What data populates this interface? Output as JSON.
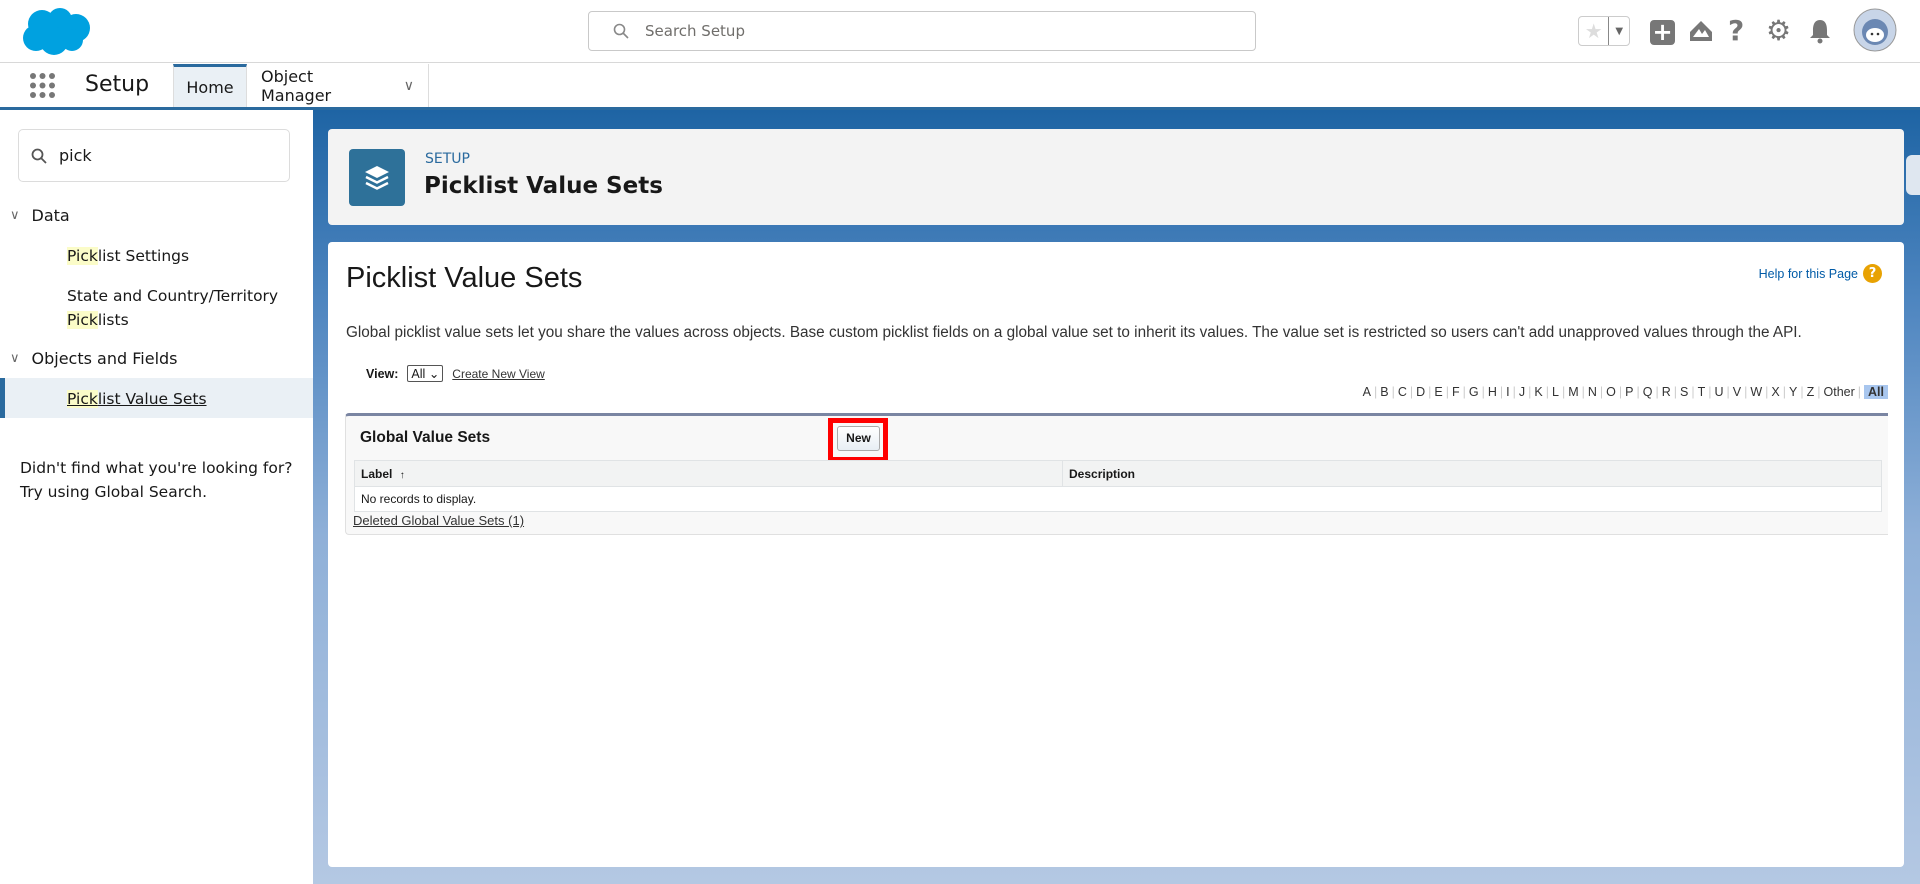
{
  "header": {
    "search_placeholder": "Search Setup",
    "icons": [
      "salesforce-cloud-logo",
      "favorite-star",
      "favorites-dropdown",
      "global-actions-plus",
      "trailhead",
      "help",
      "setup-gear",
      "notifications-bell",
      "user-avatar"
    ]
  },
  "nav": {
    "app_name": "Setup",
    "tabs": [
      {
        "label": "Home"
      },
      {
        "label": "Object Manager"
      }
    ]
  },
  "sidebar": {
    "search_value": "pick",
    "groups": [
      {
        "label": "Data",
        "items": [
          {
            "highlight": "Pick",
            "rest": "list Settings"
          },
          {
            "pre": "State and Country/Territory",
            "highlight": "Pick",
            "rest": "lists"
          }
        ]
      },
      {
        "label": "Objects and Fields",
        "items": [
          {
            "highlight": "Pick",
            "rest": "list Value Sets"
          }
        ]
      }
    ],
    "not_found_line1": "Didn't find what you're looking for?",
    "not_found_line2": "Try using Global Search."
  },
  "page_header": {
    "breadcrumb": "SETUP",
    "title": "Picklist Value Sets"
  },
  "body": {
    "title": "Picklist Value Sets",
    "help_link": "Help for this Page",
    "description": "Global picklist value sets let you share the values across objects. Base custom picklist fields on a global value set to inherit its values. The value set is restricted so users can't add unapproved values through the API.",
    "view_label": "View:",
    "view_value": "All",
    "create_view": "Create New View",
    "alphabet": [
      "A",
      "B",
      "C",
      "D",
      "E",
      "F",
      "G",
      "H",
      "I",
      "J",
      "K",
      "L",
      "M",
      "N",
      "O",
      "P",
      "Q",
      "R",
      "S",
      "T",
      "U",
      "V",
      "W",
      "X",
      "Y",
      "Z",
      "Other",
      "All"
    ],
    "list": {
      "title": "Global Value Sets",
      "new_button": "New",
      "columns": [
        "Label",
        "Description"
      ],
      "sort_indicator": "↑",
      "empty": "No records to display.",
      "deleted_link": "Deleted Global Value Sets (1)"
    }
  },
  "colors": {
    "brand_blue": "#2a6a9e",
    "highlight": "#fbfcc8",
    "annotation_red": "#ff0000"
  }
}
